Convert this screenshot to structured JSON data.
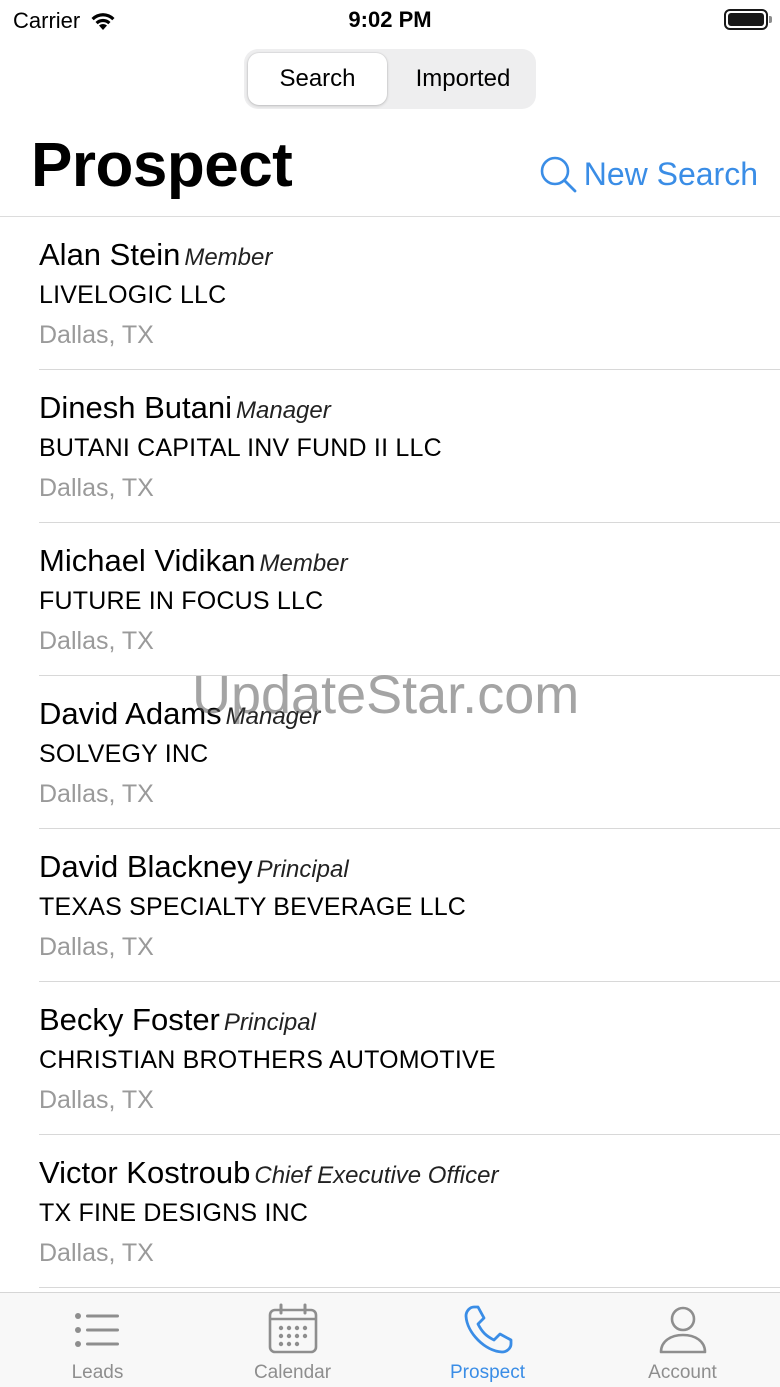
{
  "status_bar": {
    "carrier": "Carrier",
    "time": "9:02 PM"
  },
  "segmented": {
    "options": [
      "Search",
      "Imported"
    ],
    "selected": "Search"
  },
  "header": {
    "title": "Prospect",
    "new_search_label": "New Search"
  },
  "prospects": [
    {
      "name": "Alan Stein",
      "role": "Member",
      "company": "LIVELOGIC LLC",
      "location": "Dallas, TX"
    },
    {
      "name": "Dinesh Butani",
      "role": "Manager",
      "company": "BUTANI CAPITAL INV FUND II LLC",
      "location": "Dallas, TX"
    },
    {
      "name": "Michael Vidikan",
      "role": "Member",
      "company": "FUTURE IN FOCUS LLC",
      "location": "Dallas, TX"
    },
    {
      "name": "David Adams",
      "role": "Manager",
      "company": "SOLVEGY INC",
      "location": "Dallas, TX"
    },
    {
      "name": "David Blackney",
      "role": "Principal",
      "company": "TEXAS SPECIALTY BEVERAGE LLC",
      "location": "Dallas, TX"
    },
    {
      "name": "Becky Foster",
      "role": "Principal",
      "company": "CHRISTIAN BROTHERS AUTOMOTIVE",
      "location": "Dallas, TX"
    },
    {
      "name": "Victor Kostroub",
      "role": "Chief Executive Officer",
      "company": "TX FINE DESIGNS INC",
      "location": "Dallas, TX"
    }
  ],
  "watermark": "UpdateStar.com",
  "tab_bar": {
    "tabs": [
      {
        "label": "Leads",
        "icon": "list-icon"
      },
      {
        "label": "Calendar",
        "icon": "calendar-icon"
      },
      {
        "label": "Prospect",
        "icon": "phone-icon"
      },
      {
        "label": "Account",
        "icon": "person-icon"
      }
    ],
    "active": "Prospect"
  },
  "colors": {
    "accent": "#3a8de6",
    "secondary_text": "#9a9a9a",
    "tab_inactive": "#8e8e8e"
  }
}
